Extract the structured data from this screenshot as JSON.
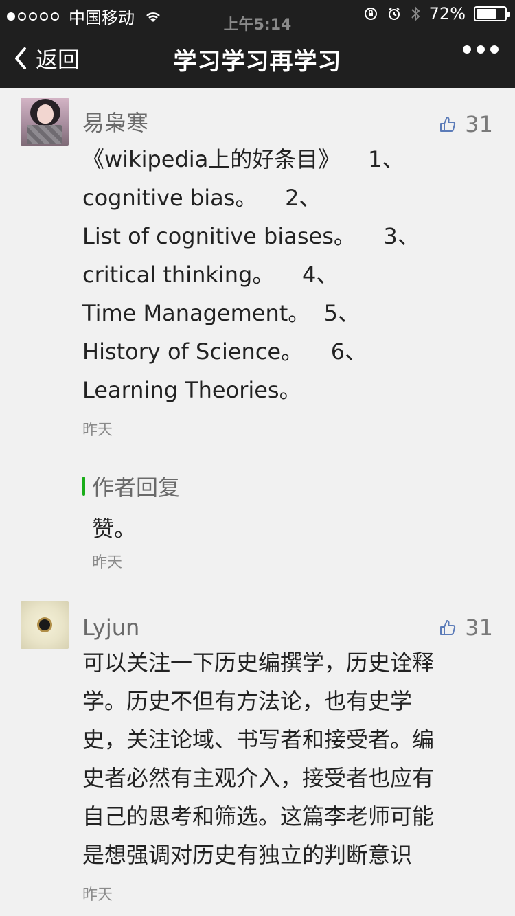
{
  "status_bar": {
    "carrier": "中国移动",
    "time": "上午5:14",
    "battery": "72%",
    "battery_level": 0.72
  },
  "nav": {
    "back_label": "返回",
    "title": "学习学习再学习"
  },
  "comments": [
    {
      "name": "易枭寒",
      "likes": "31",
      "lines": [
        "《wikipedia上的好条目》    1、",
        "cognitive bias。    2、",
        "List of cognitive biases。    3、",
        "critical thinking。    4、",
        "Time Management。  5、",
        "History of Science。    6、",
        "Learning Theories。"
      ],
      "time": "昨天",
      "reply": {
        "label": "作者回复",
        "content": "赞。",
        "time": "昨天"
      }
    },
    {
      "name": "Lyjun",
      "likes": "31",
      "lines": [
        "可以关注一下历史编撰学，历史诠释",
        "学。历史不但有方法论，也有史学",
        "史，关注论域、书写者和接受者。编",
        "史者必然有主观介入，接受者也应有",
        "自己的思考和筛选。这篇李老师可能",
        "是想强调对历史有独立的判断意识"
      ],
      "time": "昨天"
    }
  ],
  "colors": {
    "nav_bg": "#1f1f1f",
    "page_bg": "#f1f1f1",
    "reply_accent": "#1aad19"
  }
}
